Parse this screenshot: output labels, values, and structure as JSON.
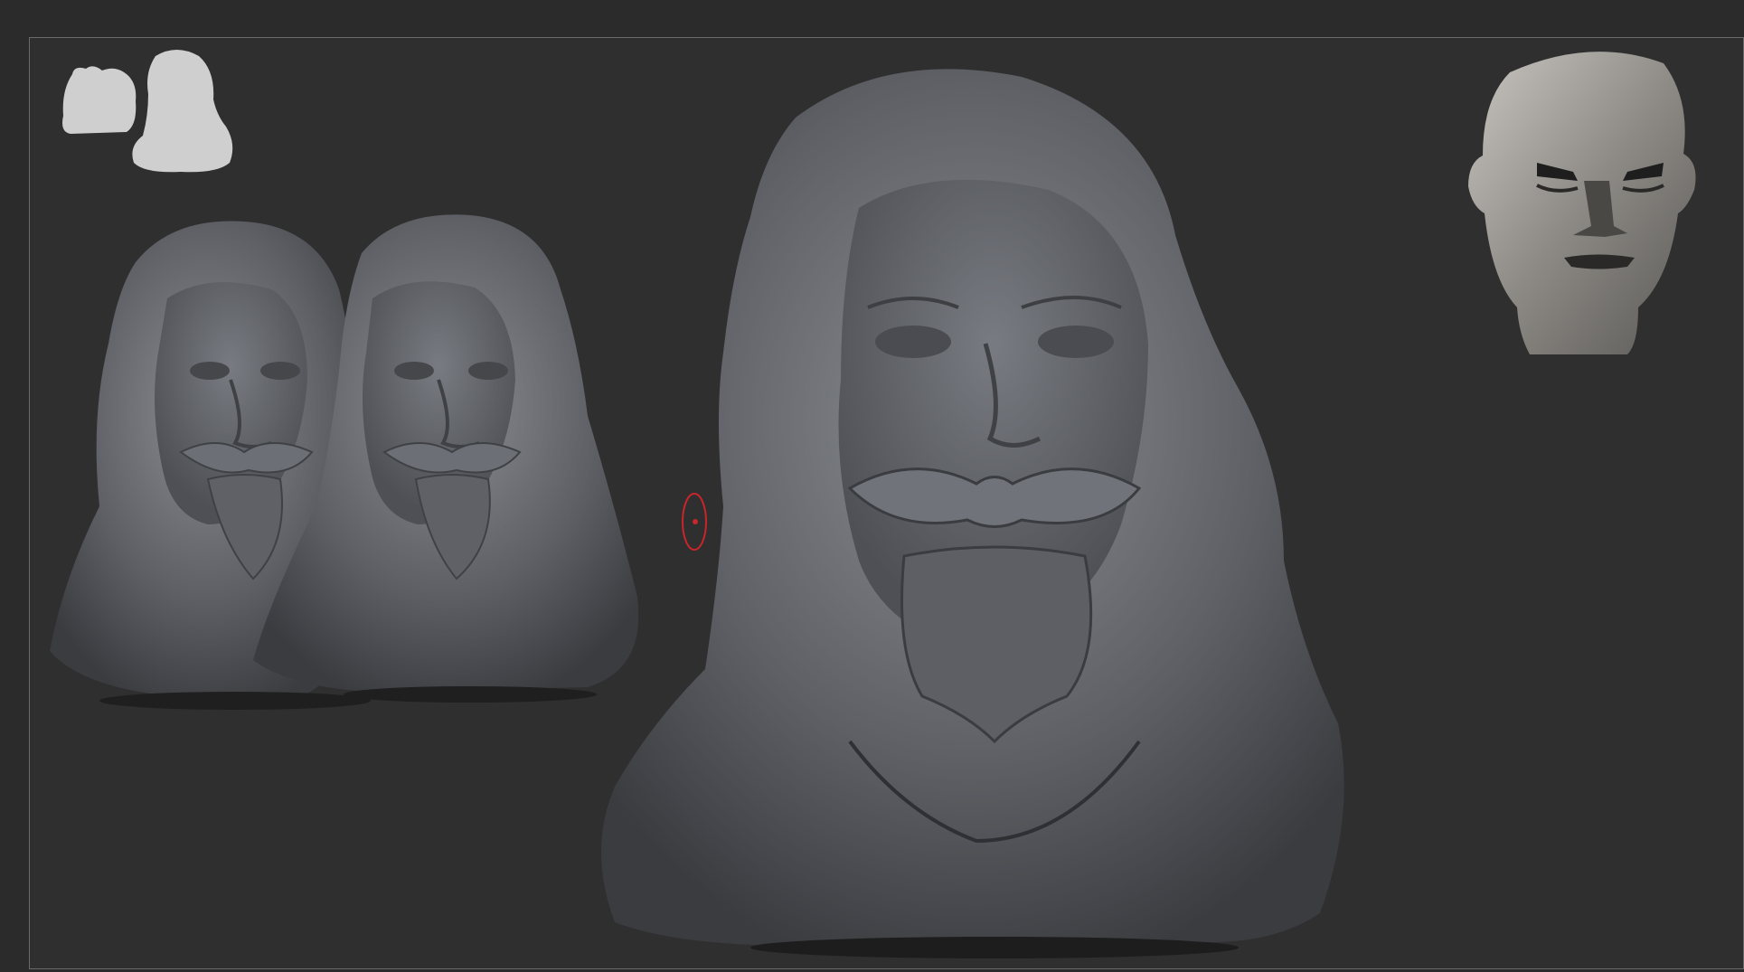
{
  "app": {
    "title": ""
  },
  "viewport": {
    "background": "#2f2f2f",
    "frame_color": "#6a6a6a"
  },
  "models": [
    {
      "name": "bearded-man-bust-small-left"
    },
    {
      "name": "bearded-man-bust-small-right"
    },
    {
      "name": "bearded-man-bust-large"
    },
    {
      "name": "planar-head-reference"
    }
  ],
  "colors": {
    "clay": "#5e6065",
    "clay_light": "#8a8d93",
    "clay_dark": "#3b3c40",
    "silhouette": "#cfcfcf",
    "cursor": "#c8262b",
    "planar": "#9b9893"
  },
  "icons": {
    "silhouette": "silhouette-icon",
    "brush_cursor": "brush-cursor-icon"
  }
}
